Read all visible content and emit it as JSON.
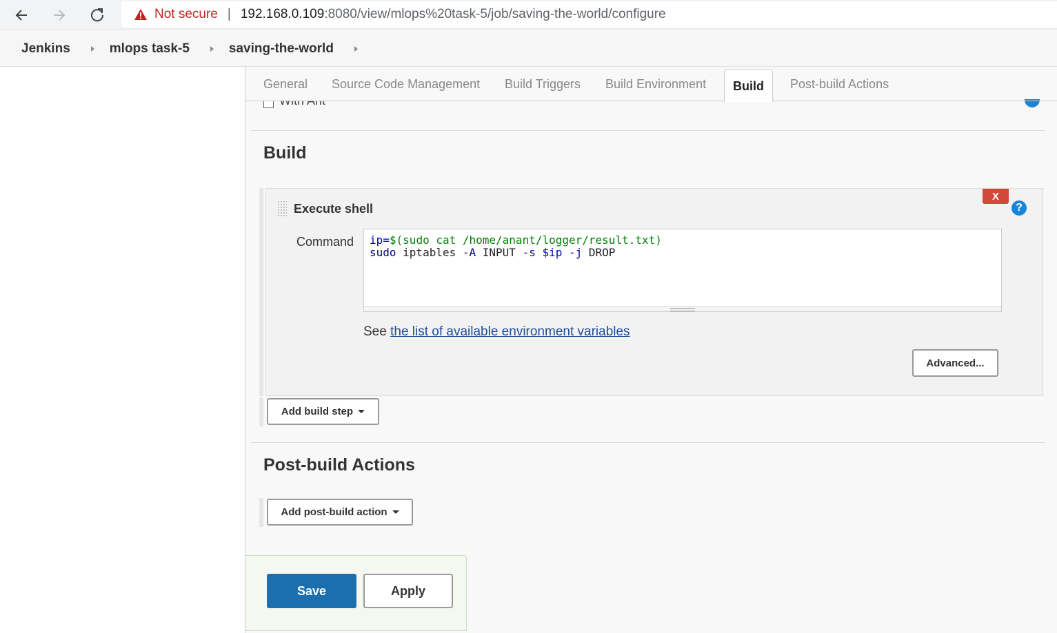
{
  "browser": {
    "not_secure": "Not secure",
    "url_host": "192.168.0.109",
    "url_path": ":8080/view/mlops%20task-5/job/saving-the-world/configure"
  },
  "breadcrumb": [
    "Jenkins",
    "mlops task-5",
    "saving-the-world"
  ],
  "tabs": [
    "General",
    "Source Code Management",
    "Build Triggers",
    "Build Environment",
    "Build",
    "Post-build Actions"
  ],
  "active_tab": "Build",
  "partial_option": "With Ant",
  "build": {
    "title": "Build",
    "step": {
      "title": "Execute shell",
      "delete_label": "X",
      "command_label": "Command",
      "command_line1": {
        "var": "ip=",
        "rest": "$(sudo cat /home/anant/logger/result.txt)"
      },
      "command_line2": {
        "sudo": "sudo",
        "iptables": " iptables ",
        "flagA": "-A",
        "input": " INPUT ",
        "flagS": "-s",
        "ip": " $ip ",
        "flagJ": "-j",
        "drop": " DROP"
      },
      "see_prefix": "See ",
      "env_link": "the list of available environment variables",
      "advanced_label": "Advanced..."
    },
    "add_step_label": "Add build step"
  },
  "post_build": {
    "title": "Post-build Actions",
    "add_action_label": "Add post-build action"
  },
  "actions": {
    "save": "Save",
    "apply": "Apply"
  },
  "colors": {
    "save_button": "#1b6fae",
    "delete_button": "#d24939",
    "help_icon": "#1a85d6",
    "warning": "#c5221f"
  }
}
